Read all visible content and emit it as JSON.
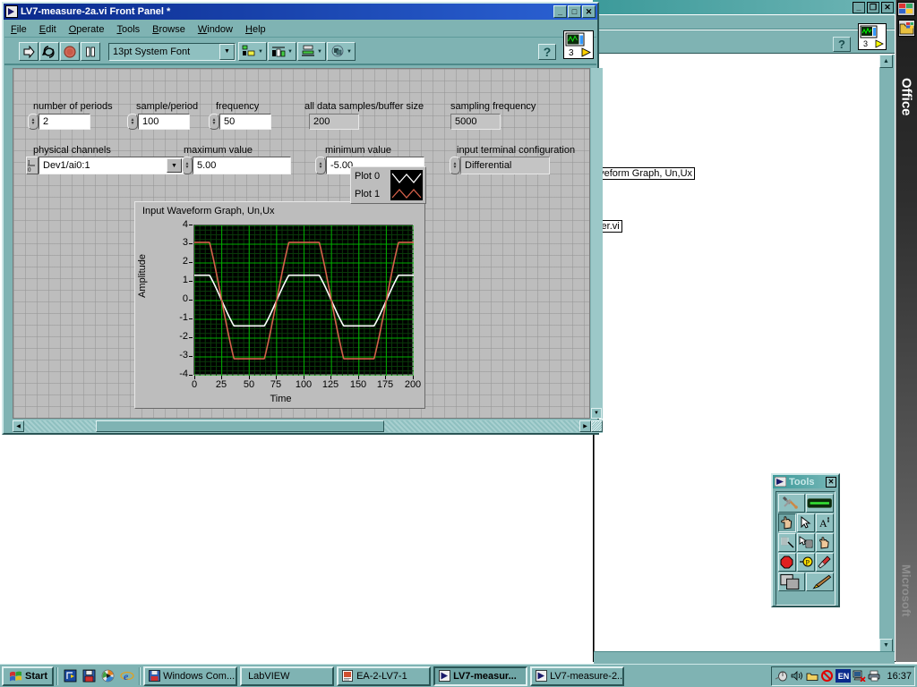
{
  "front_panel": {
    "title": "LV7-measure-2a.vi Front Panel *",
    "title_icon": "labview-vi-icon",
    "window_buttons": [
      "_",
      "□",
      "✕"
    ],
    "menus": [
      {
        "label": "File",
        "accel": "F"
      },
      {
        "label": "Edit",
        "accel": "E"
      },
      {
        "label": "Operate",
        "accel": "O"
      },
      {
        "label": "Tools",
        "accel": "T"
      },
      {
        "label": "Browse",
        "accel": "B"
      },
      {
        "label": "Window",
        "accel": "W"
      },
      {
        "label": "Help",
        "accel": "H"
      }
    ],
    "toolbar": {
      "run_icon": "run-arrow-icon",
      "run_continuous_icon": "run-continuously-icon",
      "abort_icon": "abort-execution-icon",
      "pause_icon": "pause-icon",
      "font_selector": "13pt System Font",
      "align_icon": "align-objects-icon",
      "distribute_icon": "distribute-objects-icon",
      "resize_icon": "resize-objects-icon",
      "reorder_icon": "reorder-objects-icon",
      "help_icon": "context-help-icon",
      "vi_icon": "vi-connector-icon",
      "vi_icon_number": "3"
    },
    "controls": [
      {
        "name": "number-of-periods",
        "label": "number of periods",
        "value": "2",
        "kind": "control"
      },
      {
        "name": "sample-per-period",
        "label": "sample/period",
        "value": "100",
        "kind": "control"
      },
      {
        "name": "frequency",
        "label": "frequency",
        "value": "50",
        "kind": "control"
      },
      {
        "name": "all-data-samples-buffer-size",
        "label": "all data samples/buffer size",
        "value": "200",
        "kind": "indicator"
      },
      {
        "name": "sampling-frequency",
        "label": "sampling frequency",
        "value": "5000",
        "kind": "indicator"
      },
      {
        "name": "physical-channels",
        "label": "physical channels",
        "value": "Dev1/ai0:1",
        "kind": "io-combo"
      },
      {
        "name": "maximum-value",
        "label": "maximum value",
        "value": "5.00",
        "kind": "control"
      },
      {
        "name": "minimum-value",
        "label": "minimum value",
        "value": "-5.00",
        "kind": "control"
      },
      {
        "name": "input-terminal-configuration",
        "label": "input terminal configuration",
        "value": "Differential",
        "kind": "enum"
      }
    ],
    "scrollbars": {
      "h_left_arrow": "◀",
      "h_right_arrow": "▶",
      "v_down_arrow": "▼"
    }
  },
  "chart_data": {
    "type": "line",
    "title": "Input Waveform Graph, Un,Ux",
    "xlabel": "Time",
    "ylabel": "Amplitude",
    "xlim": [
      0,
      200
    ],
    "ylim": [
      -4,
      4
    ],
    "xticks": [
      0,
      25,
      50,
      75,
      100,
      125,
      150,
      175,
      200
    ],
    "yticks": [
      4,
      3,
      2,
      1,
      0,
      -1,
      -2,
      -3,
      -4
    ],
    "grid": true,
    "grid_color": "#00b000",
    "background": "#000000",
    "legend_position": "top-right",
    "series": [
      {
        "name": "Plot 0",
        "color": "#ffffff",
        "amplitude": 1.35,
        "periods": 2,
        "phase_deg": 90,
        "clipped": true,
        "clip_level": 1.35
      },
      {
        "name": "Plot 1",
        "color": "#d4604a",
        "amplitude": 3.1,
        "periods": 2,
        "phase_deg": 90,
        "clipped": true,
        "clip_level": 3.1
      }
    ]
  },
  "tools_palette": {
    "title": "Tools",
    "title_icon": "labview-icon",
    "close_label": "✕",
    "tools": [
      {
        "name": "automatic-tool-selection-icon",
        "row": 0
      },
      {
        "name": "automatic-indicator-icon",
        "row": 0
      },
      {
        "name": "operate-value-hand-icon",
        "row": 1,
        "selected": true
      },
      {
        "name": "position-size-select-arrow-icon",
        "row": 1
      },
      {
        "name": "edit-text-icon",
        "row": 1
      },
      {
        "name": "connect-wire-spool-icon",
        "row": 2
      },
      {
        "name": "object-shortcut-menu-icon",
        "row": 2
      },
      {
        "name": "scroll-window-hand-icon",
        "row": 2
      },
      {
        "name": "set-clear-breakpoint-icon",
        "row": 3
      },
      {
        "name": "probe-data-icon",
        "row": 3
      },
      {
        "name": "get-color-dropper-icon",
        "row": 3
      },
      {
        "name": "set-color-squares-icon",
        "row": 4
      },
      {
        "name": "paintbrush-icon",
        "row": 4
      }
    ]
  },
  "background_window": {
    "window_buttons": [
      "_",
      "❐",
      "✕"
    ],
    "help_icon": "context-help-icon",
    "vi_icon": "vi-connector-icon",
    "vi_icon_number": "3",
    "labels": [
      {
        "text": "aveform Graph, Un,Ux",
        "name": "diagram-label-waveform-graph"
      },
      {
        "text": "dler.vi",
        "name": "diagram-label-handler-vi"
      }
    ]
  },
  "office_bar": {
    "title": "Office",
    "watermark": "Microsoft",
    "icon": "office-shortcut-icon"
  },
  "taskbar": {
    "start_label": "Start",
    "start_icon": "windows-flag-icon",
    "quick_launch": [
      {
        "name": "show-desktop-icon"
      },
      {
        "name": "save-disk-icon"
      },
      {
        "name": "media-player-icon"
      },
      {
        "name": "internet-explorer-icon"
      }
    ],
    "tasks": [
      {
        "label": "Windows Com...",
        "icon": "save-disk-icon",
        "active": false
      },
      {
        "label": "LabVIEW",
        "icon": "none",
        "active": false
      },
      {
        "label": "EA-2-LV7-1",
        "icon": "document-icon",
        "active": false
      },
      {
        "label": "LV7-measur...",
        "icon": "labview-vi-icon",
        "active": true
      },
      {
        "label": "LV7-measure-2...",
        "icon": "labview-vi-icon",
        "active": false
      }
    ],
    "tray_icons": [
      {
        "name": "mouse-icon"
      },
      {
        "name": "volume-speaker-icon"
      },
      {
        "name": "folder-icon"
      },
      {
        "name": "blocked-icon"
      },
      {
        "name": "language-indicator-icon",
        "label": "EN"
      },
      {
        "name": "network-disconnected-icon"
      },
      {
        "name": "printer-icon"
      }
    ],
    "clock": "16:37"
  }
}
